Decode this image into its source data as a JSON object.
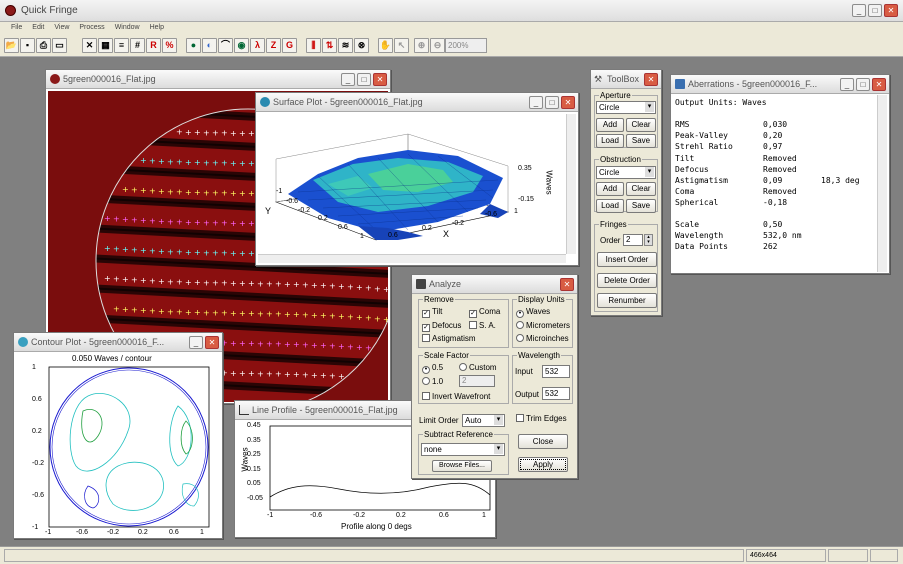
{
  "app": {
    "title": "Quick Fringe",
    "menu": [
      "File",
      "Edit",
      "View",
      "Process",
      "Window",
      "Help"
    ],
    "zoom": "200%",
    "status": "466x464"
  },
  "fringe_window": {
    "title": "5green000016_Flat.jpg"
  },
  "surface_window": {
    "title": "Surface Plot - 5green000016_Flat.jpg",
    "xlabel": "X",
    "ylabel": "Y",
    "zlabel": "Waves",
    "x_ticks": [
      "0.6",
      "0.2",
      "-0.2",
      "-0.6"
    ],
    "x_extra": [
      "1"
    ],
    "y_ticks": [
      "-1",
      "-0.6",
      "-0.2",
      "0.2",
      "0.6",
      "1"
    ],
    "z_ticks": [
      "0.35",
      "-0.15"
    ]
  },
  "contour_window": {
    "title": "Contour Plot - 5green000016_F...",
    "subtitle": "0.050 Waves / contour",
    "y_ticks": [
      "1",
      "0.6",
      "0.2",
      "-0.2",
      "-0.6",
      "-1"
    ],
    "x_ticks": [
      "-1",
      "-0.6",
      "-0.2",
      "0.2",
      "0.6",
      "1"
    ]
  },
  "profile_window": {
    "title": "Line Profile - 5green000016_Flat.jpg",
    "ylabel": "Waves",
    "xlabel": "Profile along 0 degs",
    "y_ticks": [
      "0.45",
      "0.35",
      "0.25",
      "0.15",
      "0.05",
      "-0.05"
    ],
    "x_ticks": [
      "-1",
      "-0.6",
      "-0.2",
      "0.2",
      "0.6",
      "1"
    ]
  },
  "toolbox": {
    "title": "ToolBox",
    "aperture_label": "Aperture",
    "aperture_shape": "Circle",
    "add": "Add",
    "clear": "Clear",
    "load": "Load",
    "save": "Save",
    "obstruction_label": "Obstruction",
    "obstruction_shape": "Circle",
    "fringes_label": "Fringes",
    "order_label": "Order",
    "order_value": "2",
    "insert_order": "Insert Order",
    "delete_order": "Delete Order",
    "renumber": "Renumber"
  },
  "aberrations": {
    "title": "Aberrations - 5green000016_F...",
    "output_units": "Output Units: Waves",
    "rows": [
      {
        "name": "RMS",
        "value": "0,030",
        "extra": ""
      },
      {
        "name": "Peak-Valley",
        "value": "0,20",
        "extra": ""
      },
      {
        "name": "Strehl Ratio",
        "value": "0,97",
        "extra": ""
      },
      {
        "name": "Tilt",
        "value": "Removed",
        "extra": ""
      },
      {
        "name": "Defocus",
        "value": "Removed",
        "extra": ""
      },
      {
        "name": "Astigmatism",
        "value": "0,09",
        "extra": "18,3 deg"
      },
      {
        "name": "Coma",
        "value": "Removed",
        "extra": ""
      },
      {
        "name": "Spherical",
        "value": "-0,18",
        "extra": ""
      }
    ],
    "rows2": [
      {
        "name": "Scale",
        "value": "0,50"
      },
      {
        "name": "Wavelength",
        "value": "532,0 nm"
      },
      {
        "name": "Data Points",
        "value": "262"
      }
    ]
  },
  "analyze": {
    "title": "Analyze",
    "remove_label": "Remove",
    "tilt": "Tilt",
    "coma": "Coma",
    "defocus": "Defocus",
    "sa": "S. A.",
    "astigmatism": "Astigmatism",
    "display_units_label": "Display Units",
    "waves": "Waves",
    "micrometers": "Micrometers",
    "microinches": "Microinches",
    "scale_factor_label": "Scale Factor",
    "sf_05": "0.5",
    "sf_custom": "Custom",
    "sf_10": "1.0",
    "sf_custom_value": "2",
    "invert_wavefront": "Invert Wavefront",
    "wavelength_label": "Wavelength",
    "input_label": "Input",
    "input_value": "532",
    "output_label": "Output",
    "output_value": "532",
    "limit_order_label": "Limit Order",
    "limit_order_value": "Auto",
    "trim_edges": "Trim Edges",
    "subtract_reference_label": "Subtract Reference",
    "subtract_value": "none",
    "browse_files": "Browse Files...",
    "close": "Close",
    "apply": "Apply"
  }
}
